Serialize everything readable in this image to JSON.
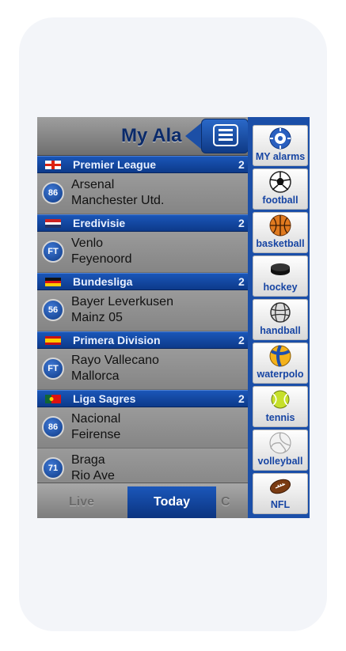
{
  "header": {
    "title": "My Ala"
  },
  "leagues": [
    {
      "name": "Premier League",
      "count": "2",
      "matches": [
        {
          "minute": "86",
          "home": "Arsenal",
          "away": "Manchester Utd."
        }
      ]
    },
    {
      "name": "Eredivisie",
      "count": "2",
      "matches": [
        {
          "minute": "FT",
          "home": "Venlo",
          "away": "Feyenoord"
        }
      ]
    },
    {
      "name": "Bundesliga",
      "count": "2",
      "matches": [
        {
          "minute": "56",
          "home": "Bayer Leverkusen",
          "away": "Mainz 05"
        }
      ]
    },
    {
      "name": "Primera Division",
      "count": "2",
      "matches": [
        {
          "minute": "FT",
          "home": "Rayo Vallecano",
          "away": "Mallorca"
        }
      ]
    },
    {
      "name": "Liga Sagres",
      "count": "2",
      "matches": [
        {
          "minute": "86",
          "home": "Nacional",
          "away": "Feirense"
        },
        {
          "minute": "71",
          "home": "Braga",
          "away": "Rio Ave"
        }
      ]
    }
  ],
  "tabs": {
    "live": "Live",
    "today": "Today",
    "calendar": "C"
  },
  "sidebar": {
    "items": [
      {
        "label": "MY alarms",
        "icon": "alarm-ball-icon"
      },
      {
        "label": "football",
        "icon": "football-icon"
      },
      {
        "label": "basketball",
        "icon": "basketball-icon"
      },
      {
        "label": "hockey",
        "icon": "hockey-puck-icon"
      },
      {
        "label": "handball",
        "icon": "handball-icon"
      },
      {
        "label": "waterpolo",
        "icon": "waterpolo-ball-icon"
      },
      {
        "label": "tennis",
        "icon": "tennis-ball-icon"
      },
      {
        "label": "volleyball",
        "icon": "volleyball-icon"
      },
      {
        "label": "NFL",
        "icon": "american-football-icon"
      }
    ]
  },
  "colors": {
    "accent": "#1b4fa8",
    "header_text": "#0a2a6a",
    "league_bar": "#1a56b8"
  }
}
